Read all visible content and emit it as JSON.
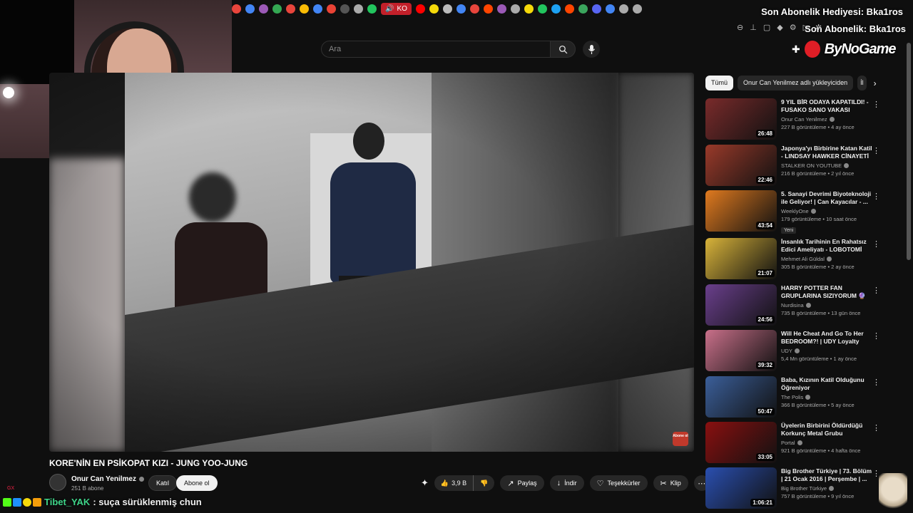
{
  "topbar": {
    "active_tab_label": "KO",
    "sub_line1": "Son Abonelik Hediyesi: Bka1ros",
    "sub_line2": "Son Abonelik: Bka1ros",
    "tab_icon_colors": [
      "#e8453c",
      "#4285f4",
      "#9b59b6",
      "#34a853",
      "#e8453c",
      "#fbbc05",
      "#4285f4",
      "#ea4335",
      "#555",
      "#aaa",
      "#22c55e",
      "#ff0000",
      "#f5d90a",
      "#bbb",
      "#4285f4",
      "#e8453c",
      "#ff4500",
      "#9b59b6",
      "#aaa",
      "#f5d90a",
      "#22c55e",
      "#1da1f2",
      "#ff4500",
      "#3ba55d",
      "#5865f2",
      "#4285f4",
      "#aaa",
      "#aaa"
    ]
  },
  "search": {
    "placeholder": "Ara"
  },
  "logo": {
    "text": "ByNoGame"
  },
  "video": {
    "title": "KORE'NİN EN PSİKOPAT KIZI - JUNG YOO-JUNG",
    "channel": "Onur Can Yenilmez",
    "subscribers": "251 B abone",
    "join_label": "Katıl",
    "subscribe_label": "Abone ol",
    "likes": "3,9 B",
    "share_label": "Paylaş",
    "download_label": "İndir",
    "thanks_label": "Teşekkürler",
    "clip_label": "Klip",
    "overlay_badge": "Abone ol"
  },
  "chat": {
    "user": "Tibet_YAK",
    "message": ": suça sürüklenmiş chun",
    "gx": "GX"
  },
  "sidebar": {
    "chips": [
      "Tümü",
      "Onur Can Yenilmez adlı yükleyiciden",
      "İl"
    ],
    "items": [
      {
        "title": "9 YIL BİR ODAYA KAPATILDI! - FUSAKO SANO VAKASI",
        "channel": "Onur Can Yenilmez",
        "views": "227 B görüntüleme • 4 ay önce",
        "duration": "26:48",
        "color": "#7a2b2b",
        "new": ""
      },
      {
        "title": "Japonya'yı Birbirine Katan Katil - LINDSAY HAWKER CİNAYETİ",
        "channel": "STALKER ON YOUTUBE",
        "views": "216 B görüntüleme • 2 yıl önce",
        "duration": "22:46",
        "color": "#9a3a2a",
        "new": ""
      },
      {
        "title": "5. Sanayi Devrimi Biyoteknoloji ile Geliyor! | Can Kayacılar - ...",
        "channel": "WeeklyOne",
        "views": "179 görüntüleme • 10 saat önce",
        "duration": "43:54",
        "color": "#e07a1f",
        "new": "Yeni"
      },
      {
        "title": "İnsanlık Tarihinin En Rahatsız Edici Ameliyatı - LOBOTOMİ",
        "channel": "Mehmet Ali Güldal",
        "views": "305 B görüntüleme • 2 ay önce",
        "duration": "21:07",
        "color": "#d8b33a",
        "new": ""
      },
      {
        "title": "HARRY POTTER FAN GRUPLARINA SIZIYORUM 🔮 ...",
        "channel": "Nurdisina",
        "views": "735 B görüntüleme • 13 gün önce",
        "duration": "24:56",
        "color": "#6a3f8c",
        "new": ""
      },
      {
        "title": "Will He Cheat And Go To Her BEDROOM?! | UDY Loyalty Test",
        "channel": "UDY",
        "views": "5,4 Mn görüntüleme • 1 ay önce",
        "duration": "39:32",
        "color": "#c9708a",
        "new": ""
      },
      {
        "title": "Baba, Kızının Katil Olduğunu Öğreniyor",
        "channel": "The Polis",
        "views": "366 B görüntüleme • 5 ay önce",
        "duration": "50:47",
        "color": "#3b5f9a",
        "new": ""
      },
      {
        "title": "Üyelerin Birbirini Öldürdüğü Korkunç Metal Grubu",
        "channel": "Portal",
        "views": "921 B görüntüleme • 4 hafta önce",
        "duration": "33:05",
        "color": "#8a1010",
        "new": ""
      },
      {
        "title": "Big Brother Türkiye | 73. Bölüm | 21 Ocak 2016 | Perşembe | ...",
        "channel": "Big Brother Türkiye",
        "views": "757 B görüntüleme • 9 yıl önce",
        "duration": "1:06:21",
        "color": "#2a4fb0",
        "new": ""
      }
    ]
  }
}
